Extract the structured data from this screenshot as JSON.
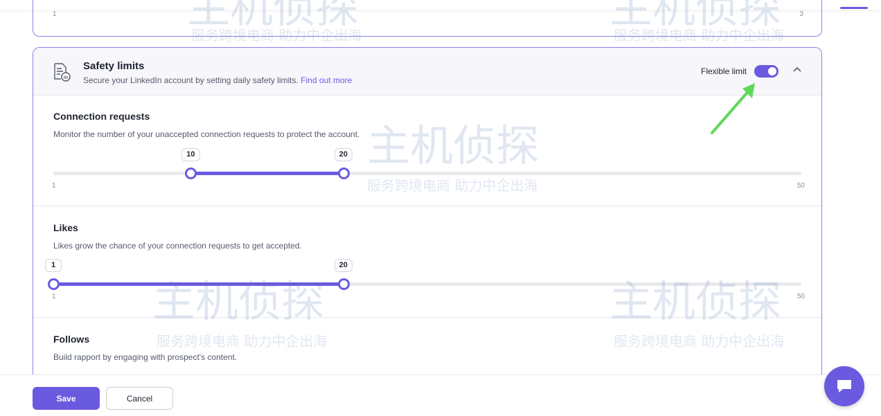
{
  "top_card": {
    "min_value": "1",
    "max_value": "3"
  },
  "safety_limits": {
    "title": "Safety limits",
    "description": "Secure your LinkedIn account by setting daily safety limits.",
    "link_label": "Find out more",
    "flexible_limit_label": "Flexible limit",
    "flexible_limit_enabled": true,
    "expanded": true,
    "icon": "linkedin-document-icon"
  },
  "sections": {
    "connection_requests": {
      "title": "Connection requests",
      "description": "Monitor the number of your unaccepted connection requests to protect the account.",
      "min": 1,
      "max": 50,
      "low": 10,
      "high": 20,
      "min_label": "1",
      "max_label": "50",
      "low_label": "10",
      "high_label": "20"
    },
    "likes": {
      "title": "Likes",
      "description": "Likes grow the chance of your connection requests to get accepted.",
      "min": 1,
      "max": 50,
      "low": 1,
      "high": 20,
      "min_label": "1",
      "max_label": "50",
      "low_label": "1",
      "high_label": "20"
    },
    "follows": {
      "title": "Follows",
      "description": "Build rapport by engaging with prospect's content."
    }
  },
  "footer": {
    "save_label": "Save",
    "cancel_label": "Cancel"
  },
  "watermark": {
    "brand": "主机侦探",
    "tagline": "服务跨境电商 助力中企出海"
  },
  "colors": {
    "accent": "#6a5ae0",
    "annotation_arrow": "#5fd85a",
    "border": "#8b7fe8"
  }
}
